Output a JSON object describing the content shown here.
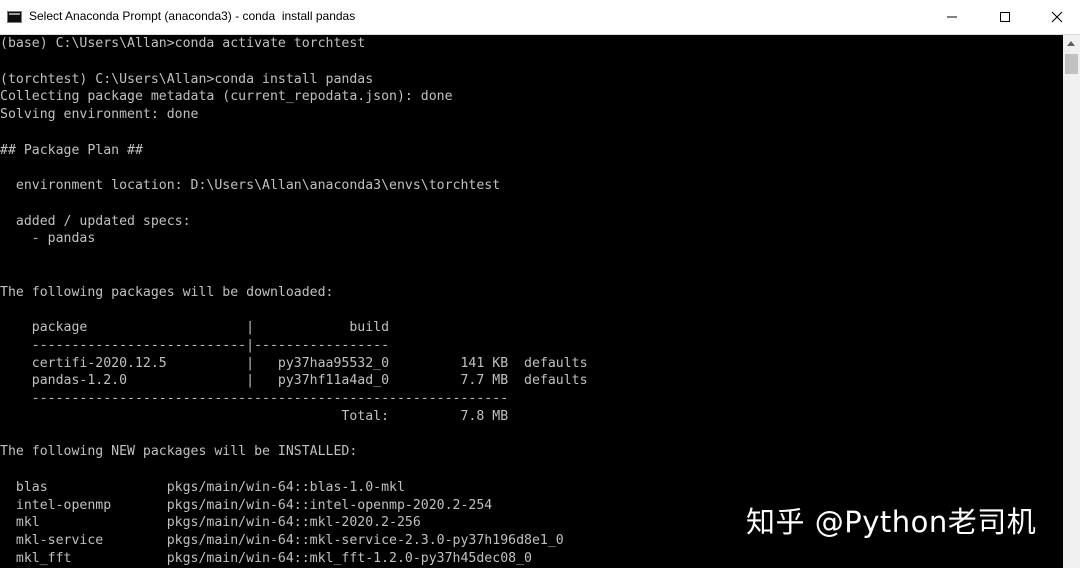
{
  "window": {
    "title": "Select Anaconda Prompt (anaconda3) - conda  install pandas"
  },
  "console": {
    "lines": [
      "(base) C:\\Users\\Allan>conda activate torchtest",
      "",
      "(torchtest) C:\\Users\\Allan>conda install pandas",
      "Collecting package metadata (current_repodata.json): done",
      "Solving environment: done",
      "",
      "## Package Plan ##",
      "",
      "  environment location: D:\\Users\\Allan\\anaconda3\\envs\\torchtest",
      "",
      "  added / updated specs:",
      "    - pandas",
      "",
      "",
      "The following packages will be downloaded:",
      "",
      "    package                    |            build",
      "    ---------------------------|-----------------",
      "    certifi-2020.12.5          |   py37haa95532_0         141 KB  defaults",
      "    pandas-1.2.0               |   py37hf11a4ad_0         7.7 MB  defaults",
      "    ------------------------------------------------------------",
      "                                           Total:         7.8 MB",
      "",
      "The following NEW packages will be INSTALLED:",
      "",
      "  blas               pkgs/main/win-64::blas-1.0-mkl",
      "  intel-openmp       pkgs/main/win-64::intel-openmp-2020.2-254",
      "  mkl                pkgs/main/win-64::mkl-2020.2-256",
      "  mkl-service        pkgs/main/win-64::mkl-service-2.3.0-py37h196d8e1_0",
      "  mkl_fft            pkgs/main/win-64::mkl_fft-1.2.0-py37h45dec08_0"
    ]
  },
  "watermark": {
    "text": "知乎 @Python老司机"
  },
  "icons": {
    "app": "console-app-icon",
    "minimize": "minimize-icon",
    "maximize": "maximize-icon",
    "close": "close-icon"
  },
  "colors": {
    "console_background": "#000000",
    "console_text": "#c0c0c0",
    "titlebar_background": "#ffffff"
  }
}
